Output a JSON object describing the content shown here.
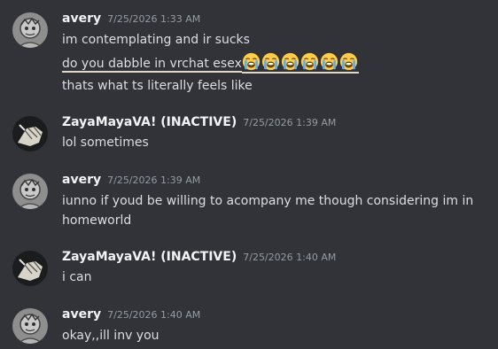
{
  "messages": [
    {
      "author": "avery",
      "timestamp": "7/25/2026 1:33 AM",
      "avatar_icon": "sketch-avatar-icon",
      "lines": [
        "im contemplating and ir sucks",
        "do you dabble in vrchat esex",
        "thats what ts literally feels like"
      ],
      "emoji_name": "loudly-crying-emoji",
      "emoji_count": 6
    },
    {
      "author": "ZayaMayaVA! (INACTIVE)",
      "timestamp": "7/25/2026 1:39 AM",
      "avatar_icon": "dark-avatar-icon",
      "lines": [
        "lol sometimes"
      ]
    },
    {
      "author": "avery",
      "timestamp": "7/25/2026 1:39 AM",
      "avatar_icon": "sketch-avatar-icon",
      "lines": [
        "iunno if youd be willing to acompany me though considering im in homeworld"
      ]
    },
    {
      "author": "ZayaMayaVA! (INACTIVE)",
      "timestamp": "7/25/2026 1:40 AM",
      "avatar_icon": "dark-avatar-icon",
      "lines": [
        "i can"
      ]
    },
    {
      "author": "avery",
      "timestamp": "7/25/2026 1:40 AM",
      "avatar_icon": "sketch-avatar-icon",
      "lines": [
        "okay,,ill inv you"
      ]
    }
  ],
  "colors": {
    "background": "#313338",
    "author": "#f2f3f5",
    "timestamp": "#949ba4",
    "text": "#dbdee1"
  }
}
